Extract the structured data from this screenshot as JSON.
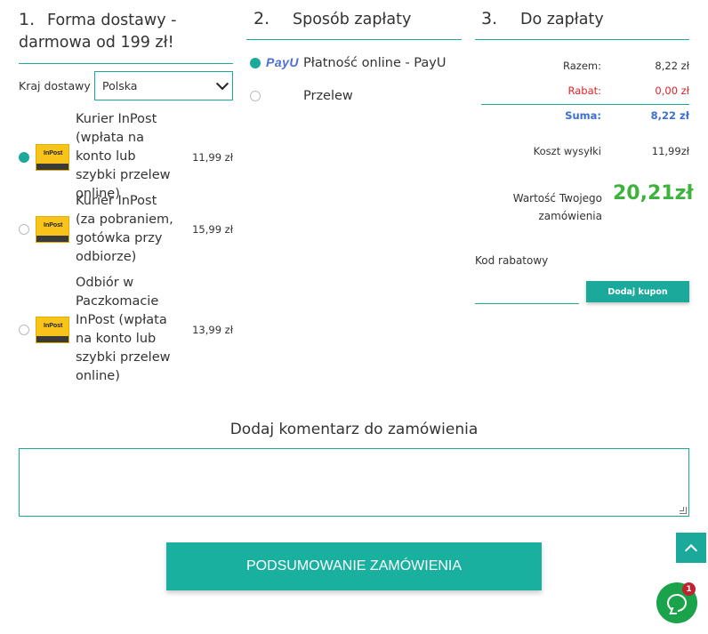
{
  "shipping": {
    "number": "1.",
    "title": "Forma dostawy - darmowa od 199 zł!",
    "country_label": "Kraj dostawy",
    "country_value": "Polska",
    "options": [
      {
        "name": "Kurier InPost (wpłata na konto lub szybki przelew online)",
        "price": "11,99 zł",
        "selected": true,
        "logo_text": "InPost"
      },
      {
        "name": "Kurier InPost (za pobraniem, gotówka przy odbiorze)",
        "price": "15,99 zł",
        "selected": false,
        "logo_text": "InPost"
      },
      {
        "name": "Odbiór w Paczkomacie InPost (wpłata na konto lub szybki przelew online)",
        "price": "13,99 zł",
        "selected": false,
        "logo_text": "InPost"
      }
    ]
  },
  "payment": {
    "number": "2.",
    "title": "Sposób zapłaty",
    "options": [
      {
        "name": "Płatność online - PayU",
        "logo": "PayU",
        "selected": true
      },
      {
        "name": "Przelew",
        "selected": false
      }
    ]
  },
  "totals": {
    "number": "3.",
    "title": "Do zapłaty",
    "razem_label": "Razem:",
    "razem_value": "8,22 zł",
    "rabat_label": "Rabat:",
    "rabat_value": "0,00 zł",
    "suma_label": "Suma:",
    "suma_value": "8,22 zł",
    "shipping_cost_label": "Koszt wysyłki",
    "shipping_cost_value": "11,99zł",
    "order_value_label": "Wartość Twojego zamówienia",
    "order_value": "20,21zł",
    "coupon_label": "Kod rabatowy",
    "coupon_value": "",
    "coupon_button": "Dodaj kupon"
  },
  "comment": {
    "title": "Dodaj komentarz do zamówienia",
    "value": ""
  },
  "summary_button": "PODSUMOWANIE ZAMÓWIENIA",
  "chat": {
    "badge_count": "1"
  },
  "colors": {
    "accent": "#1aa99a",
    "total_green": "#3db33d",
    "rabat_red": "#e02424",
    "suma_blue": "#3b6fd0",
    "chat_green": "#1aa34a",
    "badge_red": "#c0222e"
  },
  "icons": {
    "scroll_top": "chevron-up-icon",
    "chat": "chat-bubble-icon",
    "select": "chevron-down-icon"
  }
}
